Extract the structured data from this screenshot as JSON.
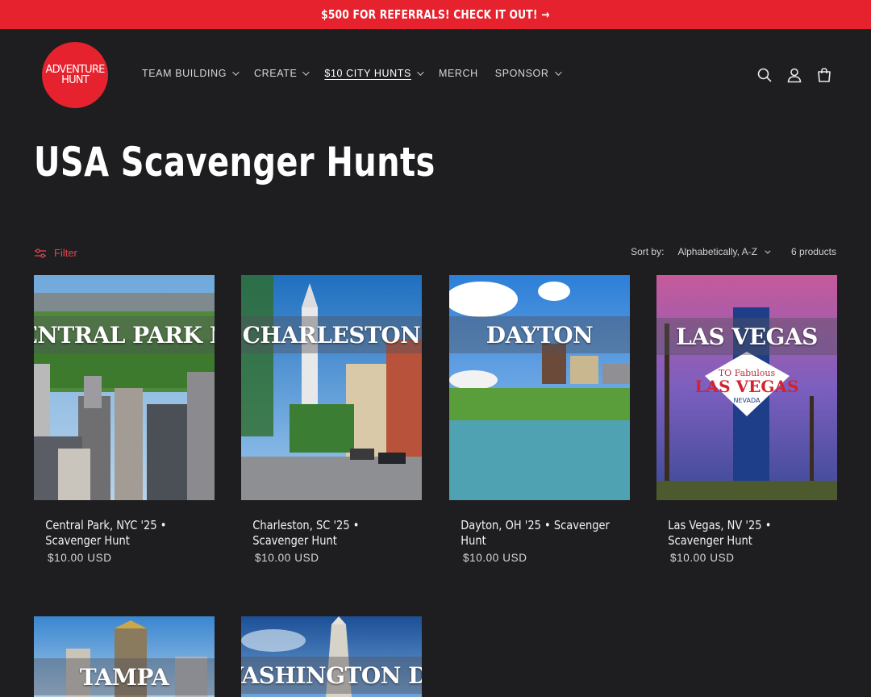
{
  "announcement": {
    "text": "$500 FOR REFERRALS! CHECK IT OUT! →"
  },
  "logo": {
    "line1": "ADVENTURE",
    "line2": "HUNT"
  },
  "nav": {
    "items": [
      {
        "label": "TEAM BUILDING",
        "has_dropdown": true
      },
      {
        "label": "CREATE",
        "has_dropdown": true
      },
      {
        "label": "$10 CITY HUNTS",
        "has_dropdown": true,
        "active": true
      },
      {
        "label": "MERCH",
        "has_dropdown": false
      },
      {
        "label": "SPONSOR",
        "has_dropdown": true
      }
    ]
  },
  "header_icons": [
    "search-icon",
    "account-icon",
    "cart-icon"
  ],
  "page": {
    "title": "USA Scavenger Hunts"
  },
  "toolbar": {
    "filter_label": "Filter",
    "sort_label": "Sort by:",
    "sort_value": "Alphabetically, A-Z",
    "product_count": "6 products"
  },
  "products": [
    {
      "image_text": "CENTRAL PARK NY",
      "title": "Central Park, NYC '25 • Scavenger Hunt",
      "price": "$10.00 USD"
    },
    {
      "image_text": "CHARLESTON",
      "title": "Charleston, SC '25 • Scavenger Hunt",
      "price": "$10.00 USD"
    },
    {
      "image_text": "DAYTON",
      "title": "Dayton, OH '25 • Scavenger Hunt",
      "price": "$10.00 USD"
    },
    {
      "image_text": "LAS VEGAS",
      "title": "Las Vegas, NV '25 • Scavenger Hunt",
      "price": "$10.00 USD"
    },
    {
      "image_text": "TAMPA",
      "title": "",
      "price": ""
    },
    {
      "image_text": "WASHINGTON DC",
      "title": "",
      "price": ""
    }
  ],
  "colors": {
    "accent": "#e5222d",
    "background": "#1e1e20",
    "filter": "#e5444e"
  }
}
